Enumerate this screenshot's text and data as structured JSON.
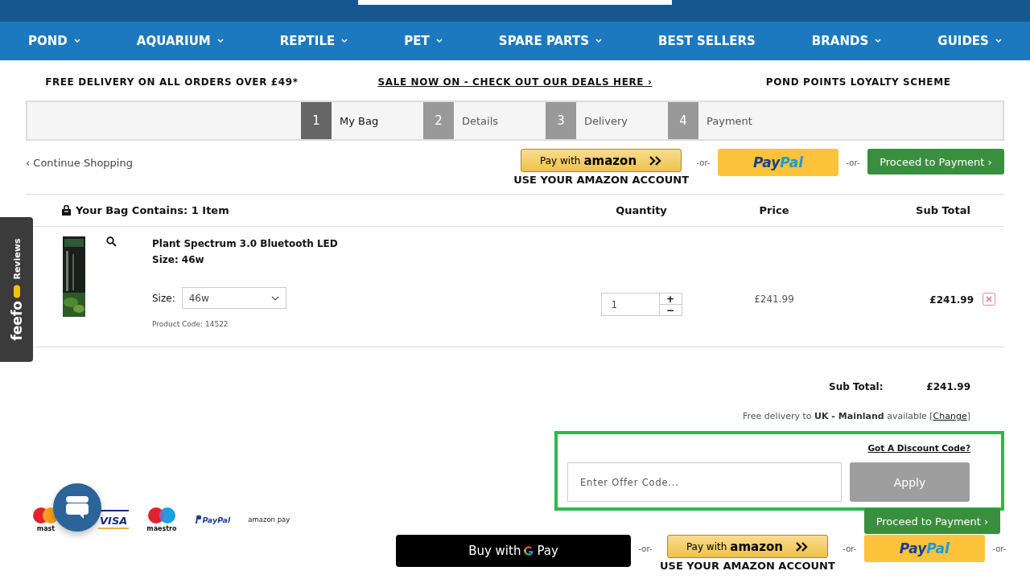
{
  "nav": [
    {
      "label": "POND",
      "dropdown": true
    },
    {
      "label": "AQUARIUM",
      "dropdown": true
    },
    {
      "label": "REPTILE",
      "dropdown": true
    },
    {
      "label": "PET",
      "dropdown": true
    },
    {
      "label": "SPARE PARTS",
      "dropdown": true
    },
    {
      "label": "BEST SELLERS",
      "dropdown": false
    },
    {
      "label": "BRANDS",
      "dropdown": true
    },
    {
      "label": "GUIDES",
      "dropdown": true
    }
  ],
  "promo": [
    {
      "text": "FREE DELIVERY ON ALL ORDERS OVER £49*",
      "link": false
    },
    {
      "text": "SALE NOW ON - CHECK OUT OUR DEALS HERE ›",
      "link": true
    },
    {
      "text": "POND POINTS LOYALTY SCHEME",
      "link": false
    }
  ],
  "steps": [
    {
      "number": "1",
      "label": "My Bag",
      "selected": true
    },
    {
      "number": "2",
      "label": "Details",
      "selected": false
    },
    {
      "number": "3",
      "label": "Delivery",
      "selected": false
    },
    {
      "number": "4",
      "label": "Payment",
      "selected": false
    }
  ],
  "continue_link": "‹ Continue Shopping",
  "top_checkout": {
    "amazon": {
      "prefix": "Pay with",
      "brand": "amazon",
      "caption": "USE YOUR AMAZON ACCOUNT"
    },
    "separators": [
      "-or-",
      "-or-"
    ],
    "paypal": {
      "part1": "Pay",
      "part2": "Pal"
    },
    "proceed": "Proceed to Payment ›"
  },
  "table": {
    "columns": [
      "Your Bag Contains: 1 Item",
      "Quantity",
      "Price",
      "Sub Total"
    ],
    "rows": [
      {
        "name": "Plant Spectrum 3.0 Bluetooth LED",
        "size_line": "Size: 46w",
        "size_label": "Size:",
        "size_value": "46w",
        "product_code": "Product Code: 14522",
        "quantity": "1",
        "plus": "+",
        "minus": "−",
        "price": "£241.99",
        "subtotal": "£241.99"
      }
    ]
  },
  "totals": {
    "label": "Sub Total:",
    "value": "£241.99",
    "delivery_note": "Free delivery to **UK - Mainland** available [",
    "delivery_link": "Change",
    "delivery_end": "]"
  },
  "discount": {
    "highlighted": true,
    "title": "Got A Discount Code?",
    "placeholder": "Enter Offer Code...",
    "button": "Apply"
  },
  "bottom_checkout": {
    "proceed": "Proceed to Payment ›",
    "gpay": {
      "prefix": "Buy with",
      "suffix": "Pay"
    },
    "separators": [
      "-or-",
      "-or-",
      "-or-"
    ],
    "amazon": {
      "prefix": "Pay with",
      "brand": "amazon",
      "caption": "USE YOUR AMAZON ACCOUNT"
    },
    "paypal": {
      "part1": "Pay",
      "part2": "Pal"
    }
  },
  "payment_logos": [
    {
      "kind": "mastercard",
      "label": "mast"
    },
    {
      "kind": "visa",
      "label": "VISA"
    },
    {
      "kind": "maestro",
      "label": "maestro"
    },
    {
      "kind": "paypal",
      "label": "PayPal"
    },
    {
      "kind": "amazonpay",
      "label": "amazon pay"
    }
  ],
  "feefo": {
    "brand": "feefo",
    "label": "Reviews"
  }
}
